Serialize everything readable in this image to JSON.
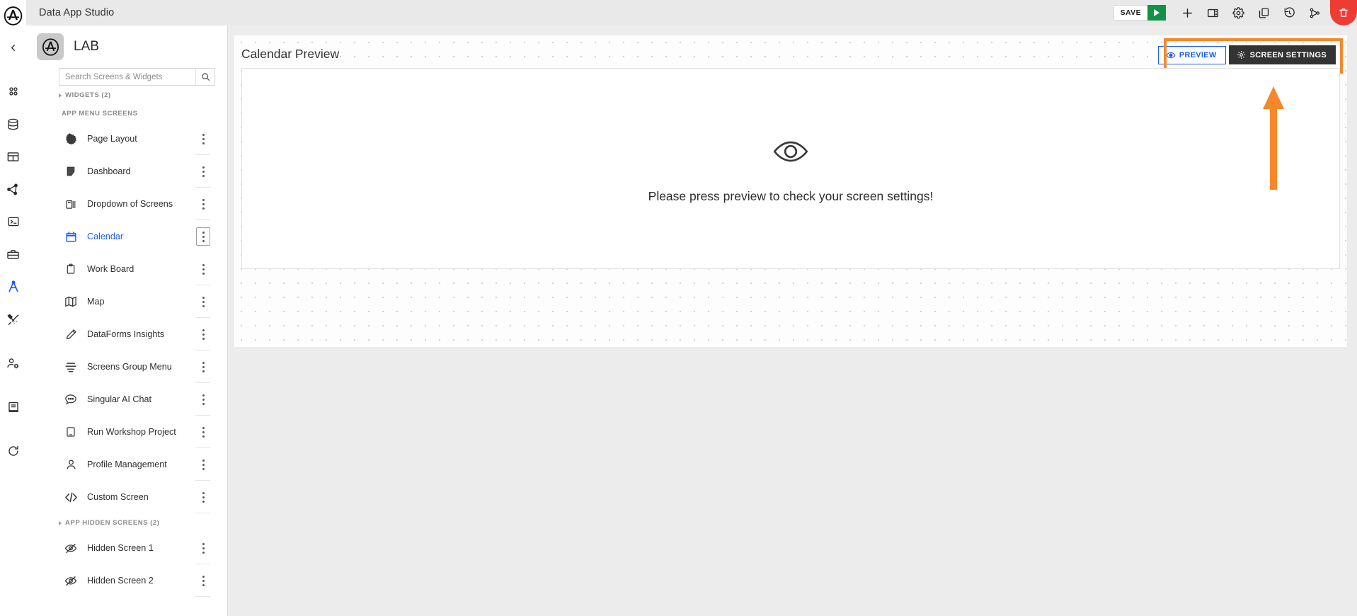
{
  "topbar": {
    "title": "Data App Studio",
    "save_label": "SAVE",
    "icons": [
      {
        "name": "run-button",
        "glyph": "play"
      },
      {
        "name": "add-button",
        "glyph": "plus"
      },
      {
        "name": "layout-panel-button",
        "glyph": "panel"
      },
      {
        "name": "settings-button",
        "glyph": "gear"
      },
      {
        "name": "duplicate-button",
        "glyph": "copy"
      },
      {
        "name": "history-button",
        "glyph": "history"
      },
      {
        "name": "branch-button",
        "glyph": "branch"
      },
      {
        "name": "delete-button",
        "glyph": "trash"
      }
    ],
    "delete_color": "#ee3b33",
    "run_color": "#119245"
  },
  "rail": {
    "logo": "app-logo",
    "items": [
      {
        "name": "collapse-icon",
        "glyph": "chevron-left",
        "active": false
      },
      {
        "name": "apps-icon",
        "glyph": "dots-grid",
        "active": false
      },
      {
        "name": "database-icon",
        "glyph": "database",
        "active": false
      },
      {
        "name": "table-icon",
        "glyph": "table",
        "active": false
      },
      {
        "name": "graph-icon",
        "glyph": "graph",
        "active": false
      },
      {
        "name": "terminal-icon",
        "glyph": "terminal",
        "active": false
      },
      {
        "name": "toolbox-icon",
        "glyph": "toolbox",
        "active": false
      },
      {
        "name": "data-app-studio-icon",
        "glyph": "compass",
        "active": true
      },
      {
        "name": "tools-icon",
        "glyph": "tools",
        "active": false
      },
      {
        "name": "user-settings-icon",
        "glyph": "user-gear",
        "active": false
      },
      {
        "name": "docs-icon",
        "glyph": "book",
        "active": false
      },
      {
        "name": "refresh-icon",
        "glyph": "refresh",
        "active": false
      }
    ],
    "active_color": "#1a5cff"
  },
  "sidebar": {
    "app_name": "LAB",
    "search": {
      "placeholder": "Search Screens & Widgets",
      "value": ""
    },
    "widgets_group": "WIDGETS (2)",
    "app_menu_header": "APP MENU SCREENS",
    "hidden_group": "APP HIDDEN SCREENS (2)",
    "screens": [
      {
        "label": "Page Layout",
        "icon": "page-layout-icon",
        "active": false
      },
      {
        "label": "Dashboard",
        "icon": "dashboard-icon",
        "active": false
      },
      {
        "label": "Dropdown of Screens",
        "icon": "dropdown-screens-icon",
        "active": false
      },
      {
        "label": "Calendar",
        "icon": "calendar-icon",
        "active": true
      },
      {
        "label": "Work Board",
        "icon": "work-board-icon",
        "active": false
      },
      {
        "label": "Map",
        "icon": "map-icon",
        "active": false
      },
      {
        "label": "DataForms Insights",
        "icon": "pencil-icon",
        "active": false
      },
      {
        "label": "Screens Group Menu",
        "icon": "menu-lines-icon",
        "active": false
      },
      {
        "label": "Singular AI Chat",
        "icon": "chat-bubble-icon",
        "active": false
      },
      {
        "label": "Run Workshop Project",
        "icon": "tablet-icon",
        "active": false
      },
      {
        "label": "Profile Management",
        "icon": "person-icon",
        "active": false
      },
      {
        "label": "Custom Screen",
        "icon": "code-icon",
        "active": false
      }
    ],
    "hidden_screens": [
      {
        "label": "Hidden Screen 1",
        "icon": "eye-off-icon",
        "active": false
      },
      {
        "label": "Hidden Screen 2",
        "icon": "eye-off-icon",
        "active": false
      }
    ],
    "active_color": "#1a5cff"
  },
  "main": {
    "page_title": "Calendar Preview",
    "preview_label": "PREVIEW",
    "screen_settings_label": "SCREEN SETTINGS",
    "empty_message": "Please press preview to check your screen settings!",
    "empty_icon": "eye-icon",
    "highlight_color": "#f68829"
  }
}
